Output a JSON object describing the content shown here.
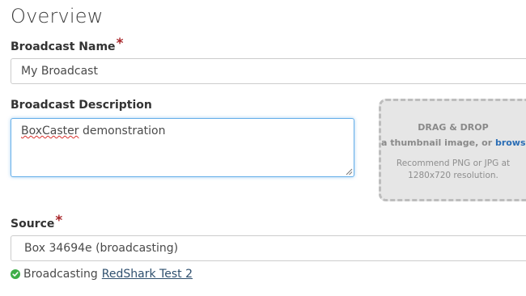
{
  "page": {
    "title": "Overview"
  },
  "broadcast_name": {
    "label": "Broadcast Name",
    "required_mark": "*",
    "value": "My Broadcast"
  },
  "broadcast_description": {
    "label": "Broadcast Description",
    "value_misspelled_word": "BoxCaster",
    "value_rest": " demonstration"
  },
  "thumbnail_dropzone": {
    "title": "DRAG & DROP",
    "subtitle_prefix": "a thumbnail image, or ",
    "browse_link": "browse",
    "hint_line1": "Recommend PNG or JPG at",
    "hint_line2": "1280x720 resolution."
  },
  "source": {
    "label": "Source",
    "required_mark": "*",
    "value": "Box 34694e (broadcasting)",
    "status_text": "Broadcasting",
    "status_link": "RedShark Test 2"
  },
  "colors": {
    "required": "#a8262a",
    "focus_border": "#66afe9",
    "link": "#2a6db5",
    "success": "#3fae49"
  },
  "icons": {
    "status": "check-circle-icon",
    "resize": "resize-grip-icon"
  }
}
